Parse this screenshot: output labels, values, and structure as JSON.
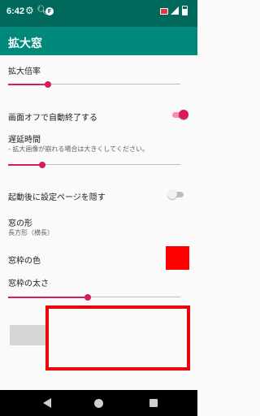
{
  "status_bar": {
    "time": "6:42",
    "icons": [
      "gear-icon",
      "search-icon",
      "app-notification-icon",
      "no-sim-icon",
      "signal-icon",
      "battery-icon"
    ],
    "app_badge_letter": "F"
  },
  "app_bar": {
    "title": "拡大窓"
  },
  "settings": {
    "zoom_ratio": {
      "label": "拡大倍率",
      "value_fraction": 0.23
    },
    "auto_close": {
      "label": "画面オフで自動終了する",
      "enabled": true
    },
    "delay_time": {
      "label": "遅延時間",
      "description": "- 拡大画像が崩れる場合は大きくしてください。",
      "value_fraction": 0.2
    },
    "hide_settings_after_start": {
      "label": "起動後に設定ページを隠す",
      "enabled": false
    },
    "window_shape": {
      "label": "窓の形",
      "value": "長方形（横長）"
    },
    "frame_color": {
      "label": "窓枠の色",
      "color": "#ff0000"
    },
    "frame_thickness": {
      "label": "窓枠の太さ",
      "value_fraction": 0.46
    }
  },
  "magnifier": {
    "frame_color": "#e8000b"
  },
  "theme": {
    "status": "#00695c",
    "app_bar": "#00897b",
    "accent": "#d81b60"
  },
  "nav_bar": {
    "icons": [
      "back-icon",
      "home-icon",
      "recents-icon"
    ]
  }
}
